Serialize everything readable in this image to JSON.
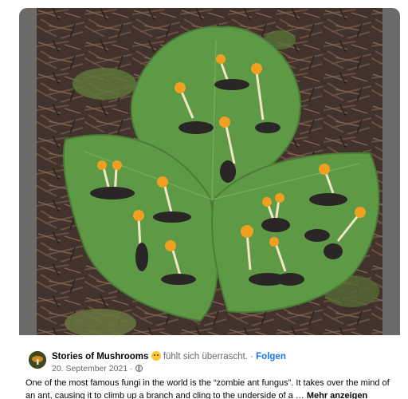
{
  "post": {
    "page_name": "Stories of Mushrooms",
    "feeling_emoji": "surprised-emoji-icon",
    "feeling_text": "fühlt sich überrascht.",
    "separator": " · ",
    "follow_label": "Folgen",
    "date": "20. September 2021",
    "date_separator": " · ",
    "privacy_icon": "globe-icon",
    "text": "One of the most famous fungi in the world is the “zombie ant fungus”. It takes over the mind of an ant, causing it to climb up a branch and cling to the underside of a … ",
    "see_more_label": "Mehr anzeigen"
  },
  "photo": {
    "subject": "ants with orange fungus stalks on three green leaves",
    "colors": {
      "ground": "#4a3a30",
      "leaf": "#5e9a46",
      "fungus_cap": "#f0a020",
      "fungus_stalk": "#f3e6c8",
      "ant": "#2a2626"
    }
  },
  "colors": {
    "accent": "#1877f2",
    "text_primary": "#050505",
    "text_secondary": "#65676b",
    "frame": "#6b6a68"
  }
}
